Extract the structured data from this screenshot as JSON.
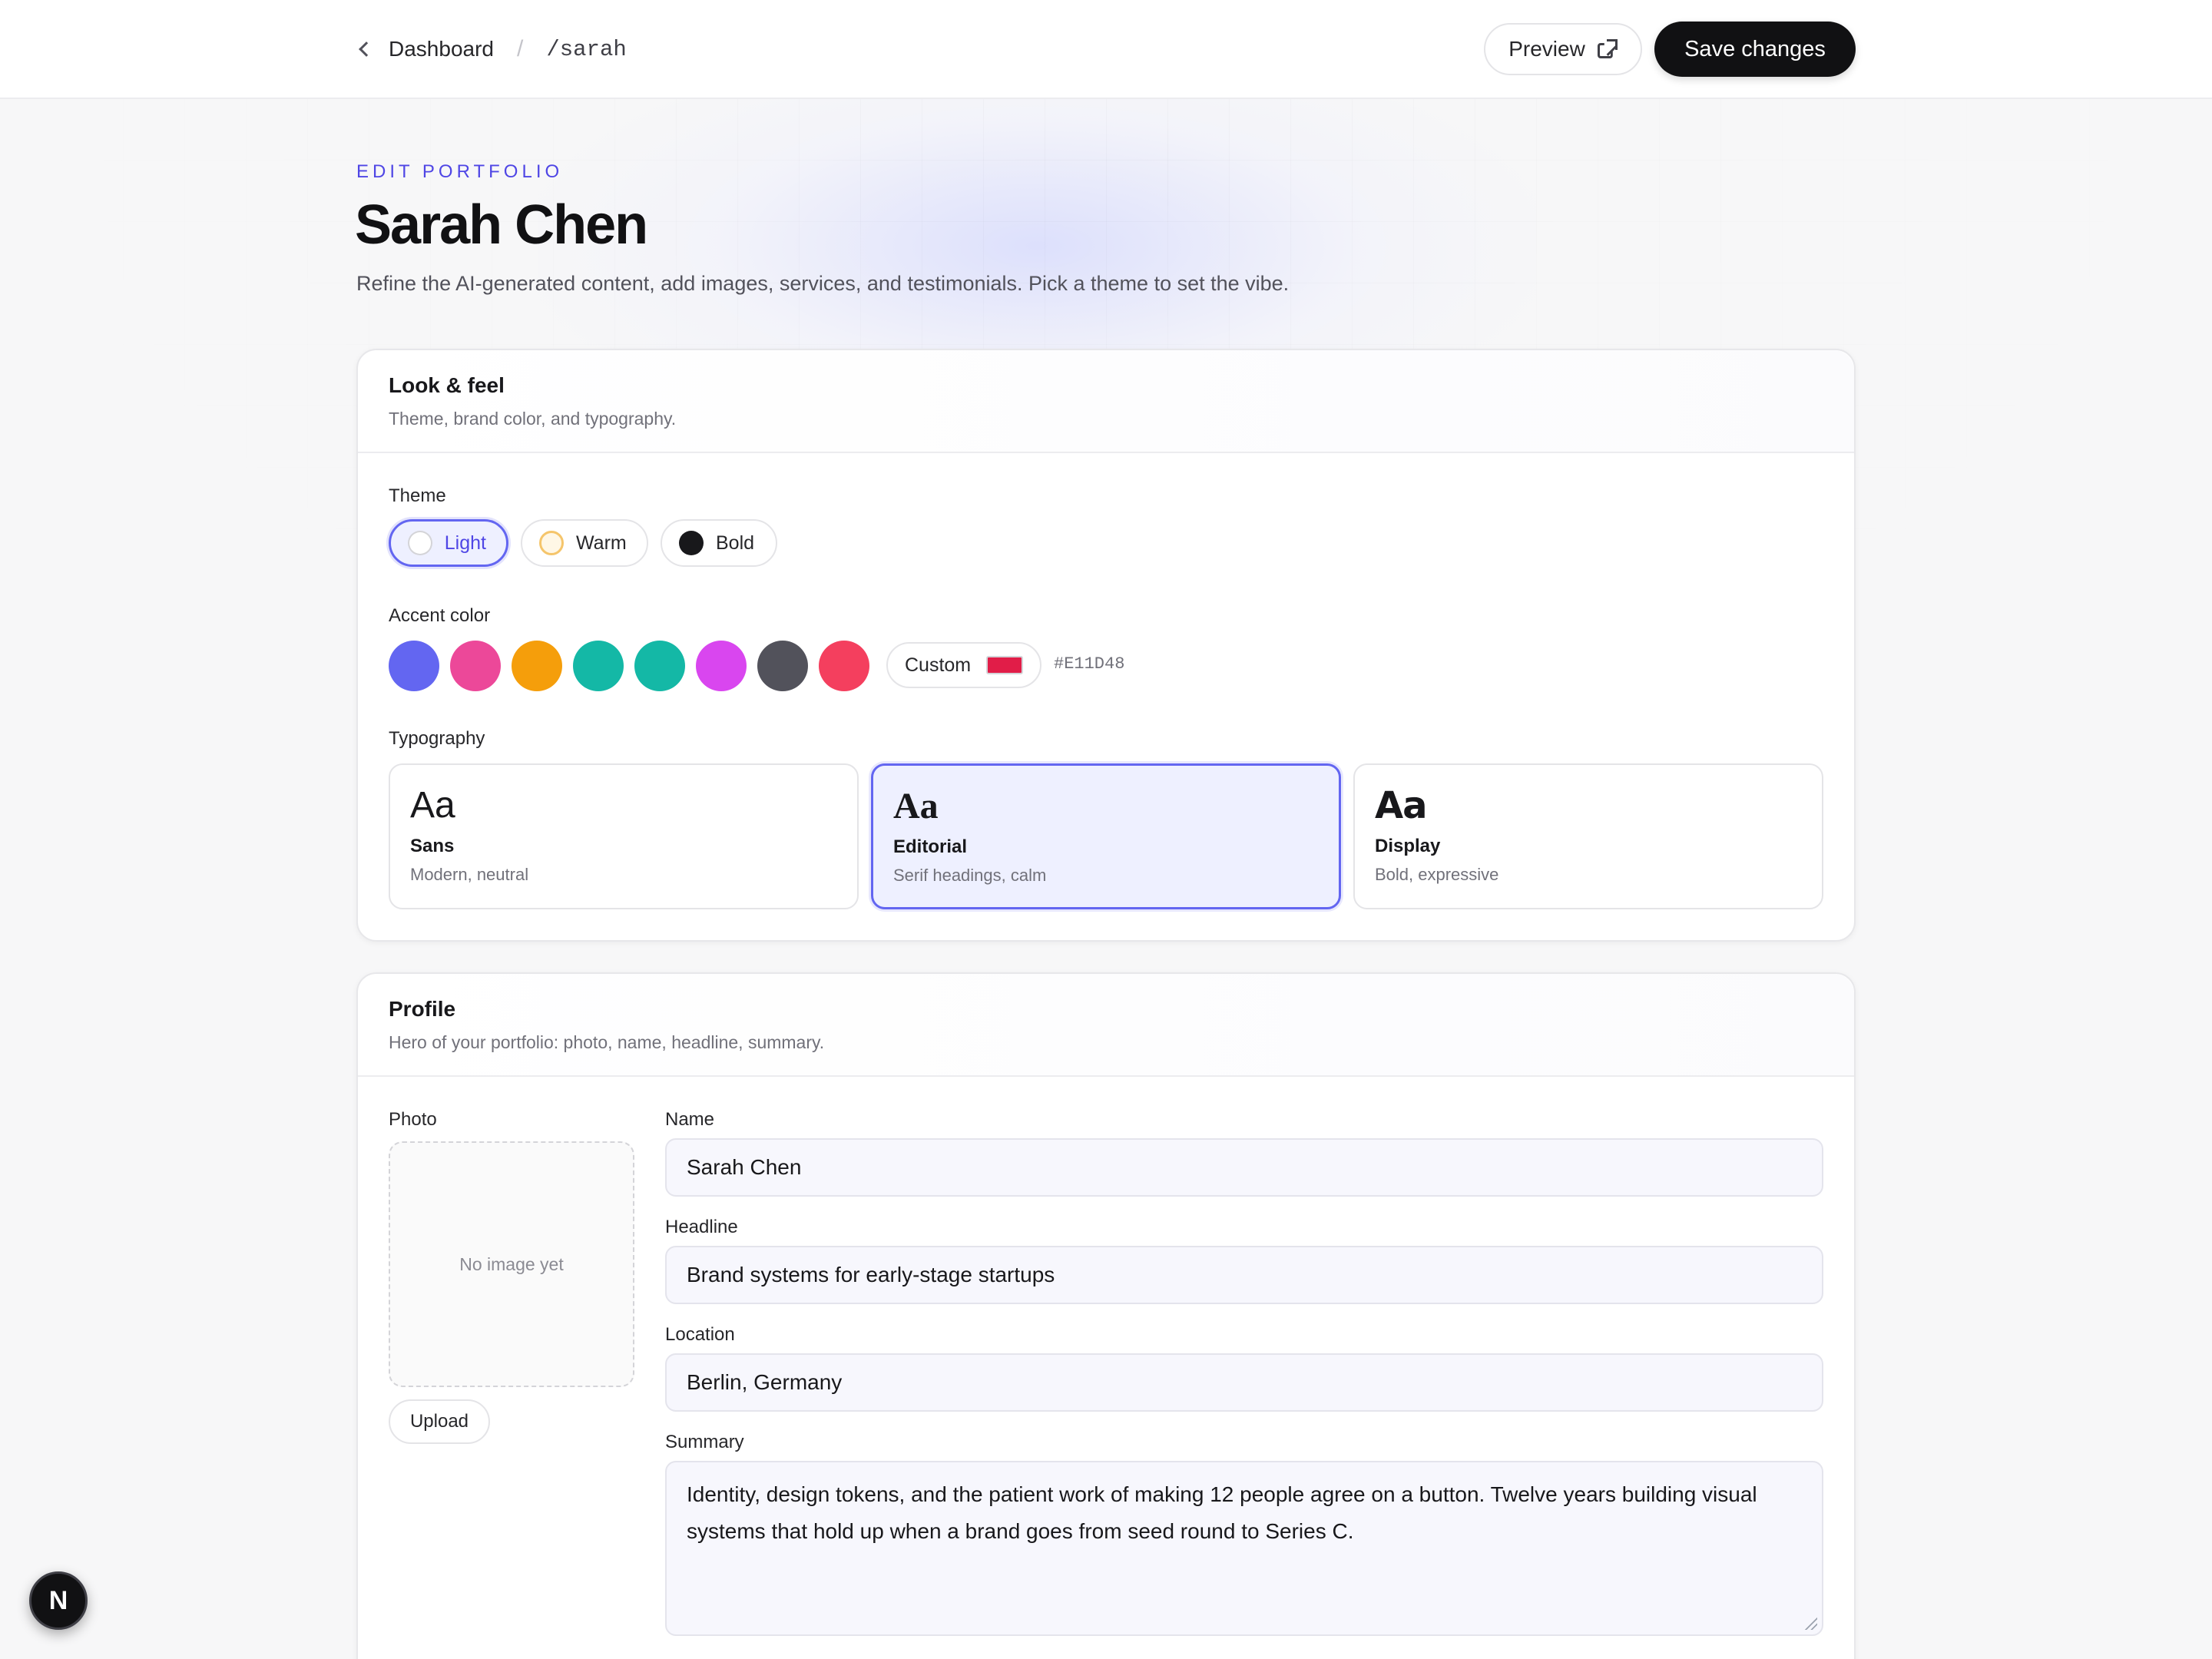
{
  "breadcrumb": {
    "back_label": "Dashboard",
    "separator": "/",
    "slug": "/sarah"
  },
  "actions": {
    "preview_label": "Preview",
    "save_label": "Save changes"
  },
  "header": {
    "eyebrow": "EDIT PORTFOLIO",
    "title": "Sarah Chen",
    "subtitle": "Refine the AI-generated content, add images, services, and testimonials. Pick a theme to set the vibe."
  },
  "look_feel": {
    "title": "Look & feel",
    "description": "Theme, brand color, and typography.",
    "theme_label": "Theme",
    "themes": [
      {
        "label": "Light",
        "selected": true
      },
      {
        "label": "Warm",
        "selected": false
      },
      {
        "label": "Bold",
        "selected": false
      }
    ],
    "accent_label": "Accent color",
    "accent_colors": [
      "#6366F1",
      "#EC4899",
      "#F59E0B",
      "#14B8A6",
      "#14B8A6",
      "#D946EF",
      "#52525B",
      "#F43F5E"
    ],
    "custom_label": "Custom",
    "custom_hex": "#E11D48",
    "typography_label": "Typography",
    "typography": [
      {
        "sample": "Aa",
        "name": "Sans",
        "description": "Modern, neutral",
        "selected": false
      },
      {
        "sample": "Aa",
        "name": "Editorial",
        "description": "Serif headings, calm",
        "selected": true
      },
      {
        "sample": "Aa",
        "name": "Display",
        "description": "Bold, expressive",
        "selected": false
      }
    ]
  },
  "profile": {
    "title": "Profile",
    "description": "Hero of your portfolio: photo, name, headline, summary.",
    "photo_label": "Photo",
    "photo_placeholder": "No image yet",
    "upload_label": "Upload",
    "name_label": "Name",
    "name_value": "Sarah Chen",
    "headline_label": "Headline",
    "headline_value": "Brand systems for early-stage startups",
    "location_label": "Location",
    "location_value": "Berlin, Germany",
    "summary_label": "Summary",
    "summary_value": "Identity, design tokens, and the patient work of making 12 people agree on a button. Twelve years building visual systems that hold up when a brand goes from seed round to Series C."
  },
  "floating_badge": {
    "letter": "N"
  }
}
